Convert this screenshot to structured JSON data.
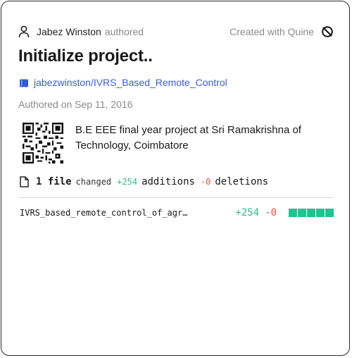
{
  "header": {
    "author_name": "Jabez Winston",
    "authored_word": "authored",
    "created_with": "Created with Quine"
  },
  "commit": {
    "title": "Initialize project..",
    "repo": "jabezwinston/IVRS_Based_Remote_Control",
    "date": "Authored on Sep 11, 2016",
    "description": "B.E EEE final year project at Sri Ramakrishna of Technology, Coimbatore"
  },
  "stats": {
    "files": "1 file",
    "changed": "changed",
    "additions": "+254",
    "additions_word": "additions",
    "deletions": "-0",
    "deletions_word": "deletions"
  },
  "files": [
    {
      "name": "IVRS_based_remote_control_of_agr…",
      "additions": "+254",
      "deletions": "-0",
      "blocks_filled": 5,
      "blocks_total": 5
    }
  ],
  "colors": {
    "additions": "#2bbf8e",
    "deletions": "#e5533c",
    "link": "#3b5bdb",
    "block": "#22c38e"
  },
  "icons": {
    "author": "user-icon",
    "brand": "quine-icon",
    "repo": "repo-icon",
    "file": "file-icon",
    "qr": "qr-code-icon"
  }
}
